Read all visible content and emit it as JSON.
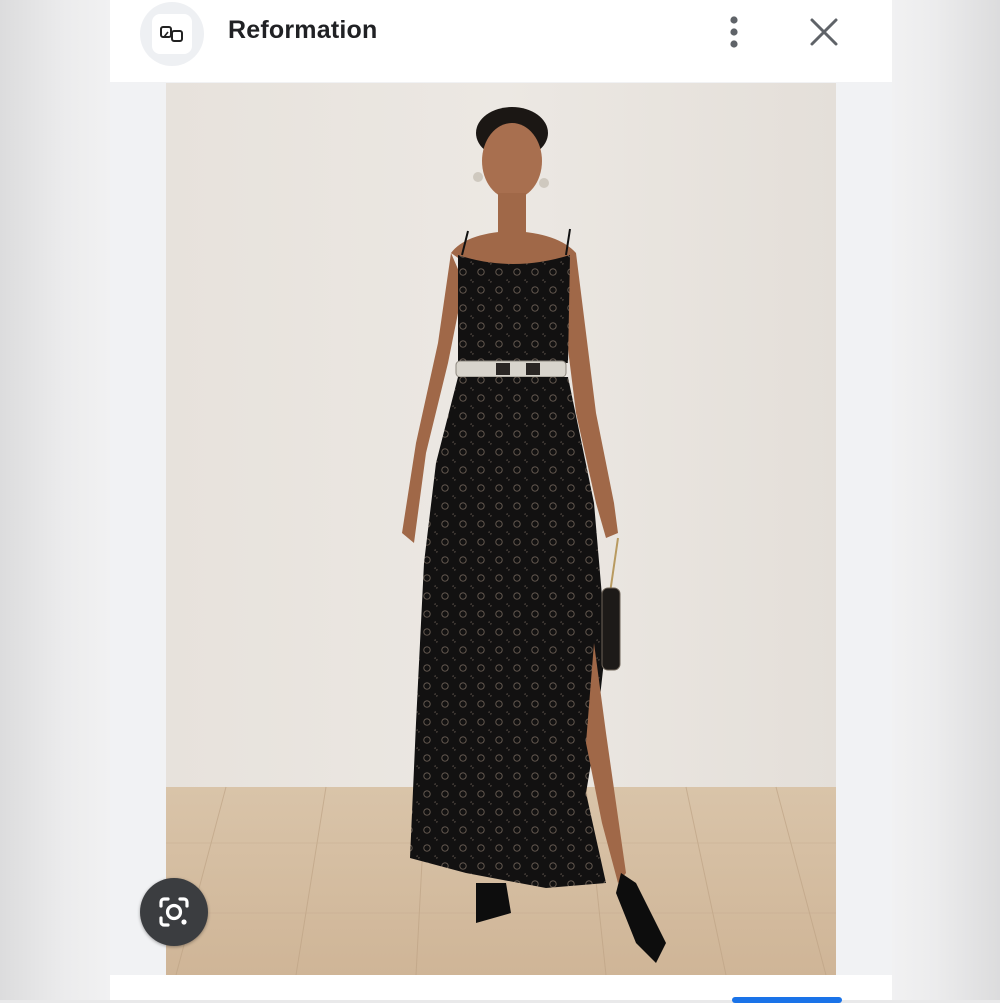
{
  "header": {
    "site_name": "Reformation",
    "site_icon": "reformation-logo-icon",
    "more_icon": "more-vert-icon",
    "close_icon": "close-icon"
  },
  "image": {
    "subject": "product-photo-dress"
  },
  "lens": {
    "icon": "google-lens-icon"
  },
  "colors": {
    "header_bg": "#ffffff",
    "panel_bg": "#f1f2f4",
    "lens_bg": "#3b3d40",
    "accent": "#1a73e8"
  }
}
